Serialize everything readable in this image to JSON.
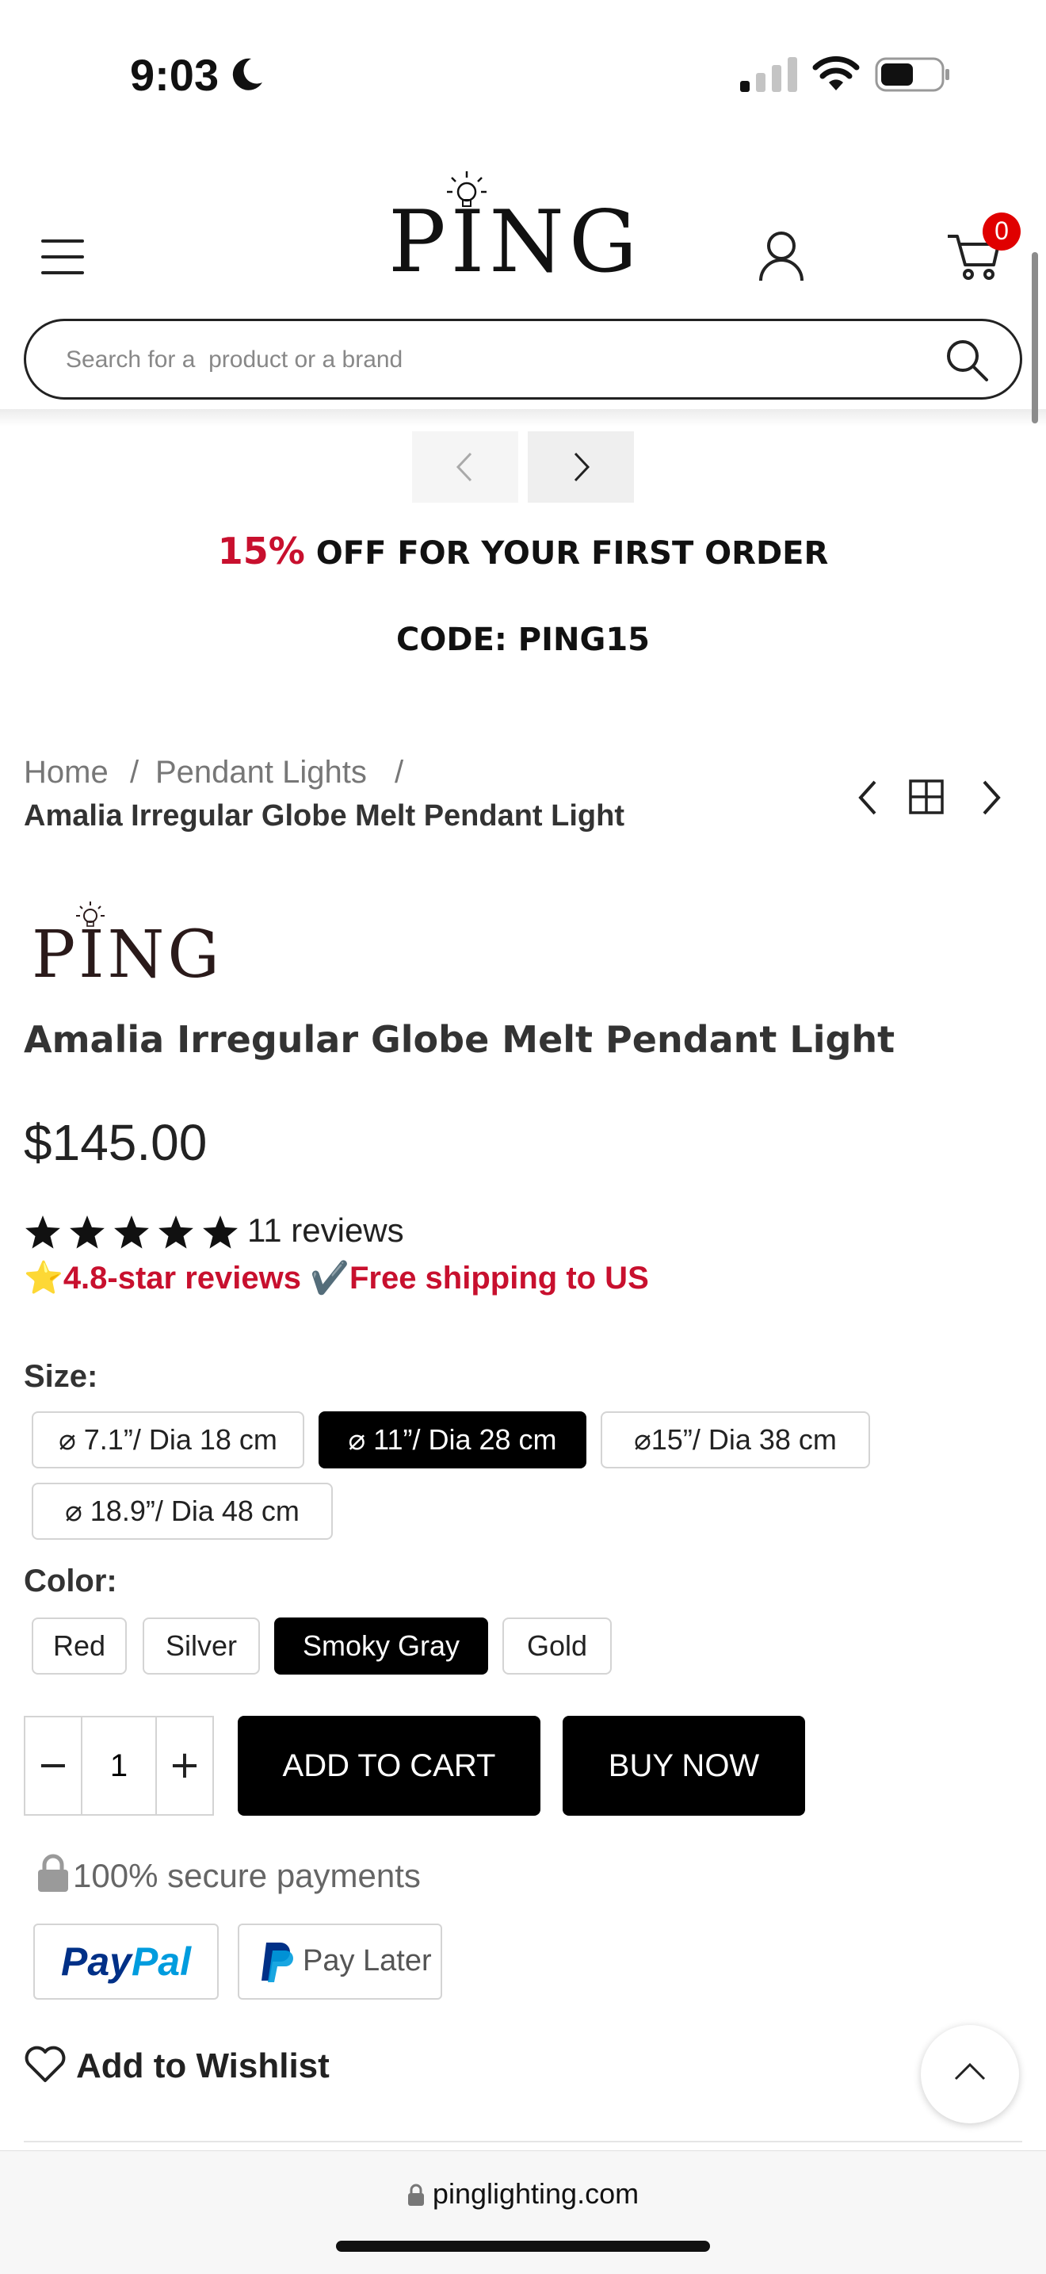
{
  "status": {
    "time": "9:03"
  },
  "header": {
    "logo_text": "PING",
    "cart_count": "0",
    "search_placeholder": "Search for a  product or a brand"
  },
  "promo": {
    "percent": "15%",
    "offer": " OFF FOR YOUR FIRST ORDER",
    "code": "CODE: PING15"
  },
  "breadcrumb": {
    "home": "Home",
    "category": "Pendant Lights",
    "separator": "/",
    "current": "Amalia Irregular Globe Melt Pendant Light"
  },
  "product": {
    "brand_logo_text": "PING",
    "title": "Amalia Irregular Globe Melt Pendant Light",
    "price": "$145.00",
    "rating": 5,
    "reviews": "11 reviews",
    "badge_star_emoji": "⭐",
    "badge_rating": "4.8-star reviews",
    "badge_check": "✔️",
    "badge_shipping": "Free shipping to US",
    "size_label": "Size:",
    "sizes": [
      "⌀ 7.1”/ Dia 18 cm",
      "⌀ 11”/ Dia 28 cm",
      "⌀15”/ Dia 38 cm",
      "⌀ 18.9”/ Dia 48 cm"
    ],
    "selected_size": "⌀ 11”/ Dia 28 cm",
    "color_label": "Color:",
    "colors": [
      "Red",
      "Silver",
      "Smoky Gray",
      "Gold"
    ],
    "selected_color": "Smoky Gray",
    "quantity": "1",
    "qty_minus": "−",
    "qty_plus": "+",
    "add_to_cart": "ADD TO CART",
    "buy_now": "BUY NOW",
    "secure_text": "100% secure payments",
    "paypal_pay": "Pay",
    "paypal_pal": "Pal",
    "pay_later": "Pay Later",
    "wishlist": "Add to Wishlist"
  },
  "browser": {
    "url": "pinglighting.com"
  },
  "colors": {
    "accent_red": "#c8102e",
    "badge_red": "#e00000",
    "paypal_dark": "#003087",
    "paypal_light": "#009cde",
    "selected_bg": "#000000"
  }
}
